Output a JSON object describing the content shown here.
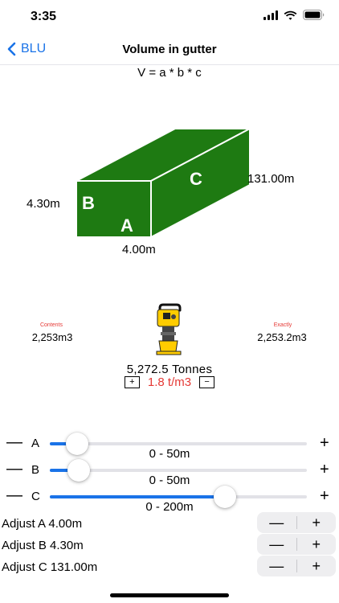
{
  "status": {
    "time": "3:35"
  },
  "nav": {
    "back_label": "BLU",
    "title": "Volume in gutter"
  },
  "formula": "V = a * b * c",
  "diagram": {
    "label_b": "B",
    "label_a": "A",
    "label_c": "C",
    "height_label": "4.30m",
    "width_label": "4.00m",
    "length_label": "131.00m",
    "box_color": "#1e7a12"
  },
  "results": {
    "contents_caption": "Contents",
    "contents_value": "2,253m3",
    "exactly_caption": "Exactly",
    "exactly_value": "2,253.2m3",
    "tonnes": "5,272.5  Tonnes",
    "density": "1.8 t/m3",
    "density_minus": "−",
    "density_plus": "+"
  },
  "sliders": [
    {
      "label": "A",
      "minus": "—",
      "plus": "+",
      "range": "0 - 50m",
      "value_fraction": 0.08
    },
    {
      "label": "B",
      "minus": "—",
      "plus": "+",
      "range": "0 - 50m",
      "value_fraction": 0.086
    },
    {
      "label": "C",
      "minus": "—",
      "plus": "+",
      "range": "0 - 200m",
      "value_fraction": 0.655
    }
  ],
  "adjust": [
    {
      "label": "Adjust A  4.00m",
      "minus": "—",
      "plus": "+"
    },
    {
      "label": "Adjust B  4.30m",
      "minus": "—",
      "plus": "+"
    },
    {
      "label": "Adjust C  131.00m",
      "minus": "—",
      "plus": "+"
    }
  ],
  "colors": {
    "accent": "#1a73e8",
    "alert": "#e53935",
    "green": "#1e7a12"
  }
}
